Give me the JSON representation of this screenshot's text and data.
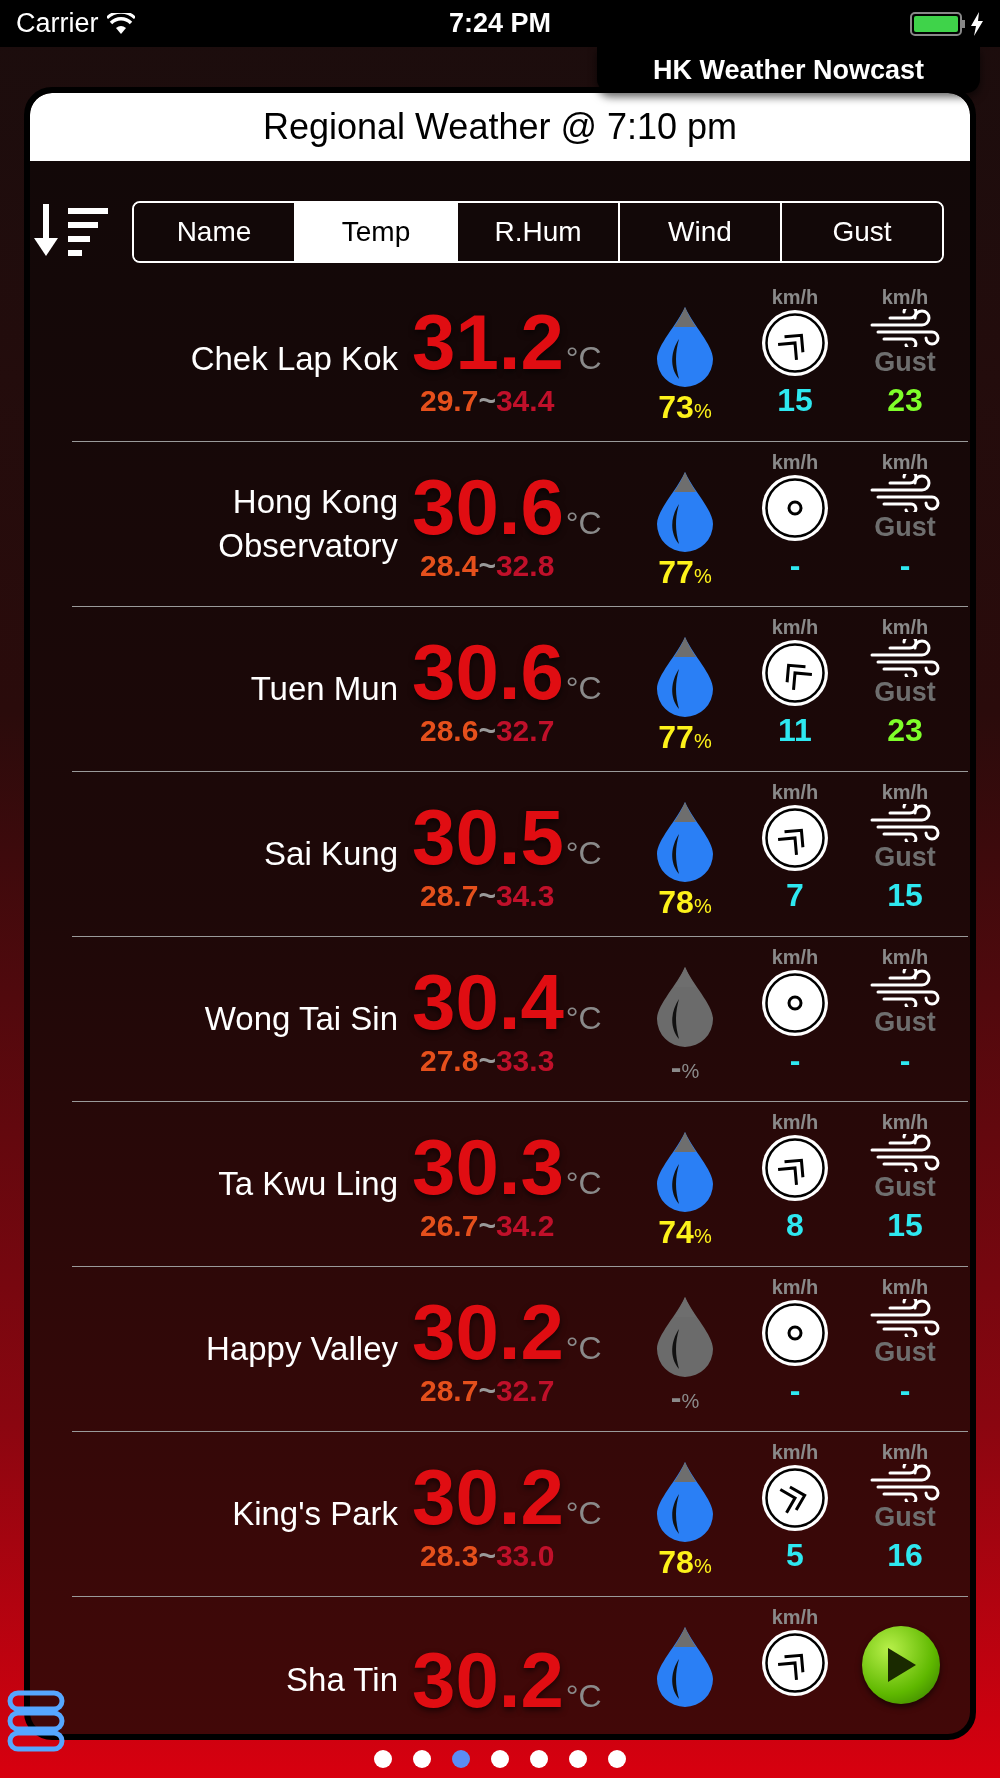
{
  "status_bar": {
    "carrier": "Carrier",
    "time": "7:24 PM"
  },
  "app_title": "HK Weather Nowcast",
  "header": "Regional Weather @ 7:10 pm",
  "sort_tabs": [
    {
      "label": "Name",
      "selected": false
    },
    {
      "label": "Temp",
      "selected": true
    },
    {
      "label": "R.Hum",
      "selected": false
    },
    {
      "label": "Wind",
      "selected": false
    },
    {
      "label": "Gust",
      "selected": false
    }
  ],
  "stations": [
    {
      "name": "Chek Lap Kok",
      "temp": "31.2",
      "unit": "°C",
      "min": "29.7",
      "sep": "~",
      "max": "34.4",
      "humidity_available": true,
      "humidity": "73",
      "pct": "%",
      "wind": {
        "kind": "northeast",
        "unit": "km/h",
        "speed": "15"
      },
      "gust": {
        "unit": "km/h",
        "label": "Gust",
        "value": "23",
        "color": "#7fff2a"
      }
    },
    {
      "name": "Hong Kong Observatory",
      "temp": "30.6",
      "unit": "°C",
      "min": "28.4",
      "sep": "~",
      "max": "32.8",
      "humidity_available": true,
      "humidity": "77",
      "pct": "%",
      "wind": {
        "kind": "calm",
        "unit": "km/h",
        "speed": "-"
      },
      "gust": {
        "unit": "km/h",
        "label": "Gust",
        "value": "-",
        "color": "#2ee8f0"
      }
    },
    {
      "name": "Tuen Mun",
      "temp": "30.6",
      "unit": "°C",
      "min": "28.6",
      "sep": "~",
      "max": "32.7",
      "humidity_available": true,
      "humidity": "77",
      "pct": "%",
      "wind": {
        "kind": "northwest",
        "unit": "km/h",
        "speed": "11"
      },
      "gust": {
        "unit": "km/h",
        "label": "Gust",
        "value": "23",
        "color": "#7fff2a"
      }
    },
    {
      "name": "Sai Kung",
      "temp": "30.5",
      "unit": "°C",
      "min": "28.7",
      "sep": "~",
      "max": "34.3",
      "humidity_available": true,
      "humidity": "78",
      "pct": "%",
      "wind": {
        "kind": "northeast",
        "unit": "km/h",
        "speed": "7"
      },
      "gust": {
        "unit": "km/h",
        "label": "Gust",
        "value": "15",
        "color": "#2ee8f0"
      }
    },
    {
      "name": "Wong Tai Sin",
      "temp": "30.4",
      "unit": "°C",
      "min": "27.8",
      "sep": "~",
      "max": "33.3",
      "humidity_available": false,
      "humidity": "-",
      "pct": "%",
      "wind": {
        "kind": "calm",
        "unit": "km/h",
        "speed": "-"
      },
      "gust": {
        "unit": "km/h",
        "label": "Gust",
        "value": "-",
        "color": "#2ee8f0"
      }
    },
    {
      "name": "Ta Kwu Ling",
      "temp": "30.3",
      "unit": "°C",
      "min": "26.7",
      "sep": "~",
      "max": "34.2",
      "humidity_available": true,
      "humidity": "74",
      "pct": "%",
      "wind": {
        "kind": "northeast",
        "unit": "km/h",
        "speed": "8"
      },
      "gust": {
        "unit": "km/h",
        "label": "Gust",
        "value": "15",
        "color": "#2ee8f0"
      }
    },
    {
      "name": "Happy Valley",
      "temp": "30.2",
      "unit": "°C",
      "min": "28.7",
      "sep": "~",
      "max": "32.7",
      "humidity_available": false,
      "humidity": "-",
      "pct": "%",
      "wind": {
        "kind": "calm",
        "unit": "km/h",
        "speed": "-"
      },
      "gust": {
        "unit": "km/h",
        "label": "Gust",
        "value": "-",
        "color": "#2ee8f0"
      }
    },
    {
      "name": "King's Park",
      "temp": "30.2",
      "unit": "°C",
      "min": "28.3",
      "sep": "~",
      "max": "33.0",
      "humidity_available": true,
      "humidity": "78",
      "pct": "%",
      "wind": {
        "kind": "east",
        "unit": "km/h",
        "speed": "5"
      },
      "gust": {
        "unit": "km/h",
        "label": "Gust",
        "value": "16",
        "color": "#2ee8f0"
      }
    },
    {
      "name": "Sha Tin",
      "temp": "30.2",
      "unit": "°C",
      "humidity_available": true,
      "wind": {
        "kind": "northeast",
        "unit": "km/h"
      }
    }
  ],
  "page_dots": [
    {
      "selected": false
    },
    {
      "selected": false
    },
    {
      "selected": true
    },
    {
      "selected": false
    },
    {
      "selected": false
    },
    {
      "selected": false
    },
    {
      "selected": false
    }
  ]
}
